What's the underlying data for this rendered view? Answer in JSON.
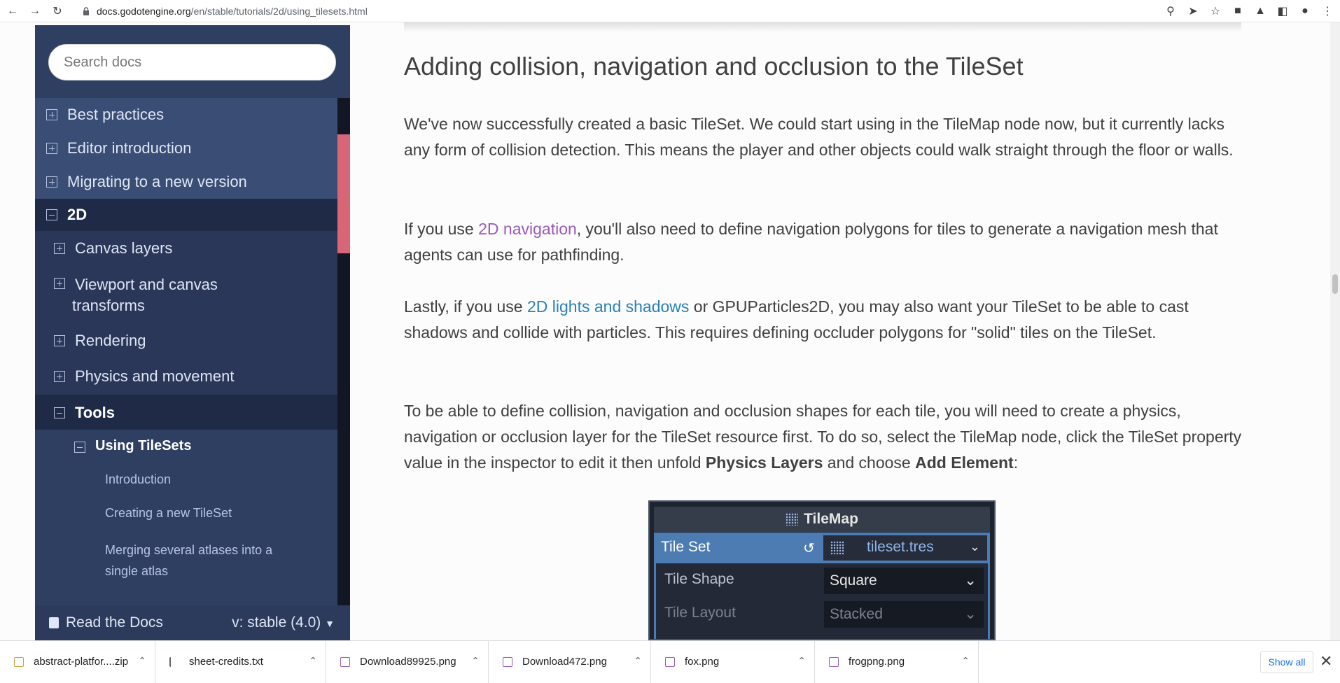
{
  "browser": {
    "url_host": "docs.godotengine.org",
    "url_path": "/en/stable/tutorials/2d/using_tilesets.html"
  },
  "sidebar": {
    "search_placeholder": "Search docs",
    "items": [
      {
        "label": "Best practices",
        "state": "collapsed"
      },
      {
        "label": "Editor introduction",
        "state": "collapsed"
      },
      {
        "label": "Migrating to a new version",
        "state": "collapsed"
      },
      {
        "label": "2D",
        "state": "expanded"
      },
      {
        "label": "Canvas layers",
        "state": "collapsed"
      },
      {
        "label": "Viewport and canvas",
        "label2": "transforms",
        "state": "collapsed"
      },
      {
        "label": "Rendering",
        "state": "collapsed"
      },
      {
        "label": "Physics and movement",
        "state": "collapsed"
      },
      {
        "label": "Tools",
        "state": "expanded"
      },
      {
        "label": "Using TileSets",
        "state": "expanded"
      },
      {
        "label": "Introduction"
      },
      {
        "label": "Creating a new TileSet"
      },
      {
        "label": "Merging several atlases into a",
        "label2": "single atlas"
      }
    ],
    "read_the_docs": "Read the Docs",
    "version": "v: stable (4.0)"
  },
  "content": {
    "heading": "Adding collision, navigation and occlusion to the TileSet",
    "p1": "We've now successfully created a basic TileSet. We could start using in the TileMap node now, but it currently lacks any form of collision detection. This means the player and other objects could walk straight through the floor or walls.",
    "p2_before": "If you use ",
    "p2_link": "2D navigation",
    "p2_after": ", you'll also need to define navigation polygons for tiles to generate a navigation mesh that agents can use for pathfinding.",
    "p3_before": "Lastly, if you use ",
    "p3_link": "2D lights and shadows",
    "p3_after": " or GPUParticles2D, you may also want your TileSet to be able to cast shadows and collide with particles. This requires defining occluder polygons for \"solid\" tiles on the TileSet.",
    "p4_before": "To be able to define collision, navigation and occlusion shapes for each tile, you will need to create a physics, navigation or occlusion layer for the TileSet resource first. To do so, select the TileMap node, click the TileSet property value in the inspector to edit it then unfold ",
    "p4_bold1": "Physics Layers",
    "p4_mid": " and choose ",
    "p4_bold2": "Add Element",
    "p4_end": ":"
  },
  "inspector": {
    "title": "TileMap",
    "tile_set_label": "Tile Set",
    "tile_set_value": "tileset.tres",
    "tile_shape_label": "Tile Shape",
    "tile_shape_value": "Square",
    "tile_layout_label": "Tile Layout",
    "tile_layout_value": "Stacked"
  },
  "downloads": [
    {
      "name": "abstract-platfor....zip",
      "kind": "zip"
    },
    {
      "name": "sheet-credits.txt",
      "kind": "txt"
    },
    {
      "name": "Download89925.png",
      "kind": "img"
    },
    {
      "name": "Download472.png",
      "kind": "img"
    },
    {
      "name": "fox.png",
      "kind": "img"
    },
    {
      "name": "frogpng.png",
      "kind": "img"
    }
  ],
  "show_all": "Show all",
  "colors": {
    "sidebar_bg": "#2f3f62",
    "accent_scroll": "#d86677",
    "link_purple": "#9b59b6",
    "link_blue": "#2980b9"
  }
}
